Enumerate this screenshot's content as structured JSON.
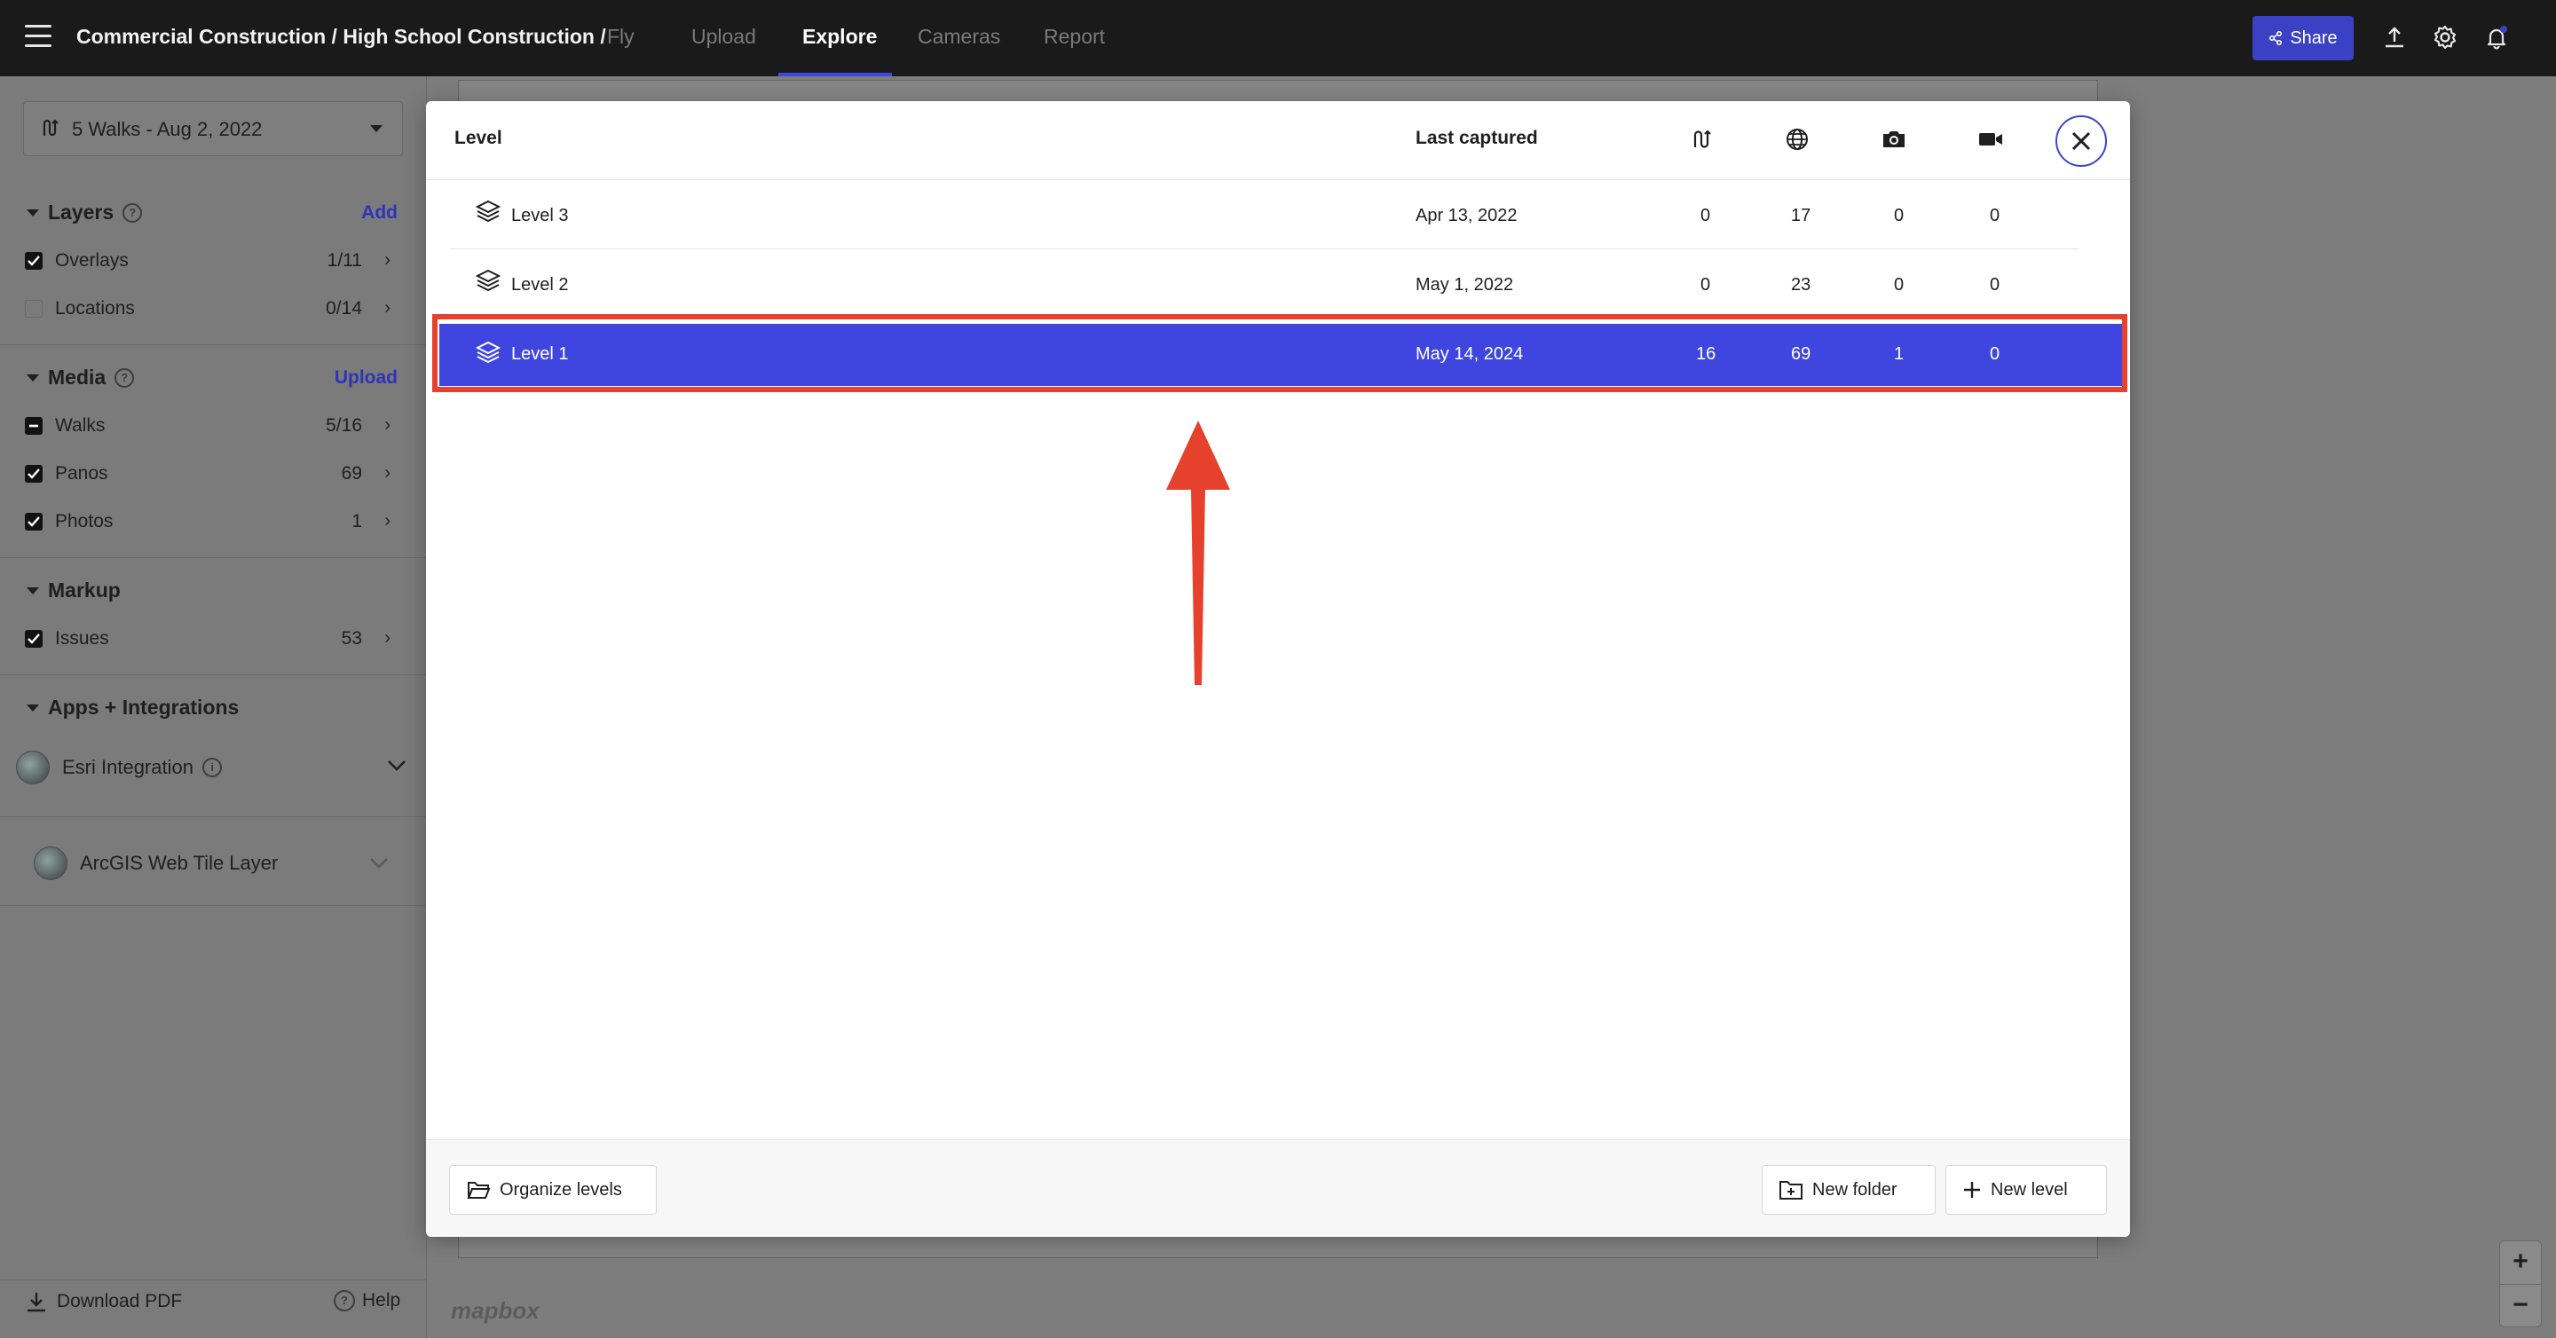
{
  "topbar": {
    "breadcrumb": "Commercial Construction / High School Construction /",
    "tabs": [
      {
        "label": "Fly",
        "active": false
      },
      {
        "label": "Upload",
        "active": false
      },
      {
        "label": "Explore",
        "active": true
      },
      {
        "label": "Cameras",
        "active": false
      },
      {
        "label": "Report",
        "active": false
      }
    ],
    "share_label": "Share",
    "accent": "#3a41c4"
  },
  "sidebar": {
    "walk_select": "5 Walks - Aug 2, 2022",
    "layers": {
      "title": "Layers",
      "action": "Add",
      "items": [
        {
          "label": "Overlays",
          "count": "1/11",
          "checked": true
        },
        {
          "label": "Locations",
          "count": "0/14",
          "checked": false
        }
      ]
    },
    "media": {
      "title": "Media",
      "action": "Upload",
      "items": [
        {
          "label": "Walks",
          "count": "5/16",
          "state": "partial"
        },
        {
          "label": "Panos",
          "count": "69",
          "checked": true
        },
        {
          "label": "Photos",
          "count": "1",
          "checked": true
        }
      ]
    },
    "markup": {
      "title": "Markup",
      "items": [
        {
          "label": "Issues",
          "count": "53",
          "checked": true
        }
      ]
    },
    "apps": {
      "title": "Apps + Integrations",
      "items": [
        {
          "label": "Esri Integration"
        },
        {
          "label": "ArcGIS Web Tile Layer"
        }
      ]
    },
    "footer": {
      "download": "Download PDF",
      "help": "Help"
    }
  },
  "map": {
    "attribution": "mapbox"
  },
  "modal": {
    "headers": {
      "level": "Level",
      "last_captured": "Last captured"
    },
    "header_icons": [
      "walk-icon",
      "globe-icon",
      "camera-icon",
      "video-icon"
    ],
    "rows": [
      {
        "name": "Level 3",
        "date": "Apr 13, 2022",
        "walks": "0",
        "panos": "17",
        "photos": "0",
        "videos": "0",
        "selected": false
      },
      {
        "name": "Level 2",
        "date": "May 1, 2022",
        "walks": "0",
        "panos": "23",
        "photos": "0",
        "videos": "0",
        "selected": false
      },
      {
        "name": "Level 1",
        "date": "May 14, 2024",
        "walks": "16",
        "panos": "69",
        "photos": "1",
        "videos": "0",
        "selected": true
      }
    ],
    "footer": {
      "organize": "Organize levels",
      "new_folder": "New folder",
      "new_level": "New level"
    },
    "selected_color": "#3f46df",
    "highlight_color": "#e6412d"
  },
  "zoom": {
    "in": "+",
    "out": "−"
  }
}
